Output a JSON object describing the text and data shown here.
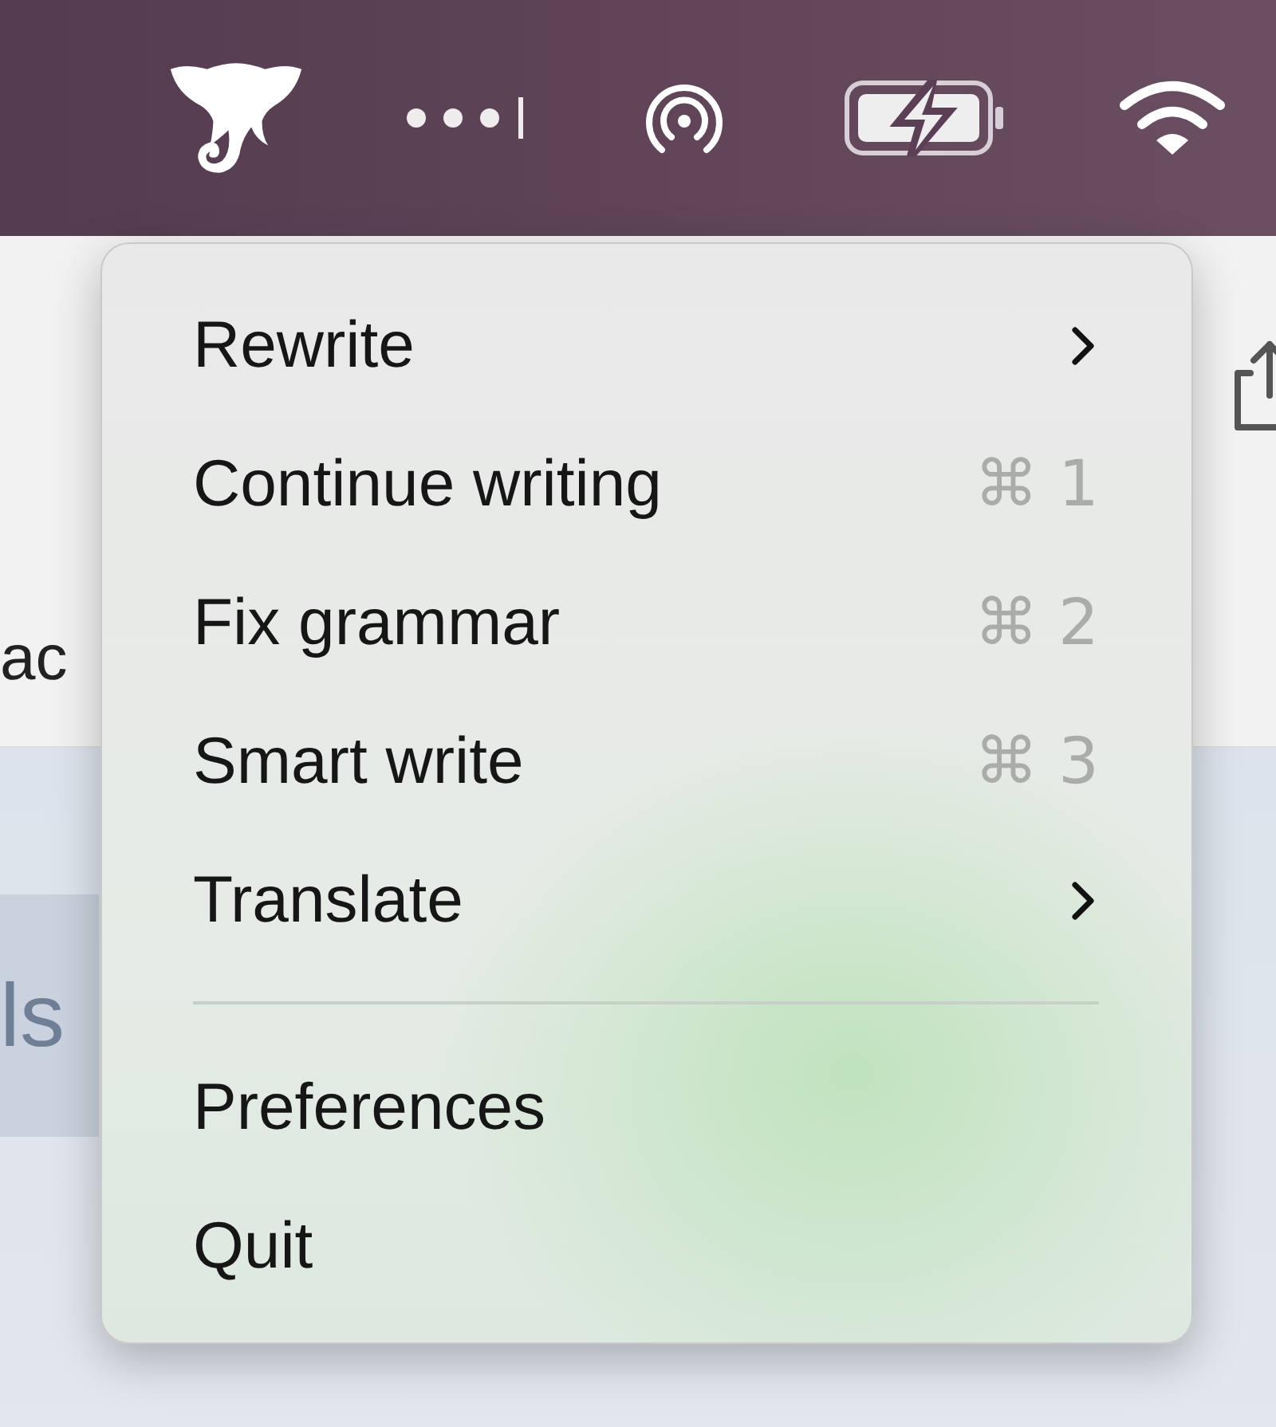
{
  "background": {
    "fragments": [
      {
        "text": "ac",
        "kind": "plain"
      },
      {
        "text": "ls",
        "kind": "chip"
      }
    ]
  },
  "menu": {
    "items": [
      {
        "kind": "submenu",
        "label": "Rewrite"
      },
      {
        "kind": "shortcut",
        "label": "Continue writing",
        "shortcut": "⌘ 1"
      },
      {
        "kind": "shortcut",
        "label": "Fix grammar",
        "shortcut": "⌘ 2"
      },
      {
        "kind": "shortcut",
        "label": "Smart write",
        "shortcut": "⌘ 3"
      },
      {
        "kind": "submenu",
        "label": "Translate"
      },
      {
        "kind": "separator"
      },
      {
        "kind": "plain",
        "label": "Preferences"
      },
      {
        "kind": "plain",
        "label": "Quit"
      }
    ]
  }
}
